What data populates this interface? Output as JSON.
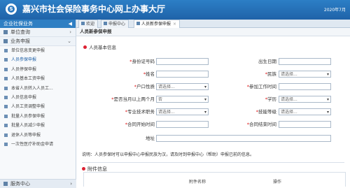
{
  "header": {
    "title": "嘉兴市社会保险事务中心网上办事大厅",
    "right_text": "2020年7月"
  },
  "sidebar": {
    "top_label": "企业社保业务",
    "groups": [
      "单位查询",
      "业务申报"
    ],
    "items": [
      "单位信息变更申报",
      "人员参保申报",
      "人员停保申报",
      "人员基本工资申报",
      "本省人员转入人员工...",
      "人员信息申报",
      "人员工资调整申报",
      "批量人员参保申报",
      "批量人员减少申报",
      "退休人员等申报",
      "一次性医疗补助金申请"
    ],
    "bottom_label": "服务中心"
  },
  "tabs": [
    "欢迎",
    "申报中心",
    "人员新参保申报"
  ],
  "page_title": "人员新参保申报",
  "section1": "人员基本信息",
  "form": {
    "id_label": "身份证号码",
    "birth_label": "出生日期",
    "name_label": "姓名",
    "nation_label": "民族",
    "nation_value": "请选择...",
    "hukou_label": "户口性质",
    "hukou_value": "请选择...",
    "work_label": "参加工作时间",
    "pay_label": "是否当月以上两个月",
    "pay_value": "否",
    "edu_label": "学历",
    "edu_value": "请选择...",
    "tech_label": "专业技术职务",
    "tech_value": "请选择...",
    "skill_label": "技能等级",
    "skill_value": "请选择...",
    "contract_start_label": "合同开始时间",
    "contract_end_label": "合同结束时间",
    "addr_label": "地址"
  },
  "note": "说明：人员参保时可以申报中心申报民族为汉，请及时到申报中心（帮助）申报已前的信息。",
  "section2": "附件信息",
  "table_headers": [
    "附件名称",
    "操作"
  ]
}
